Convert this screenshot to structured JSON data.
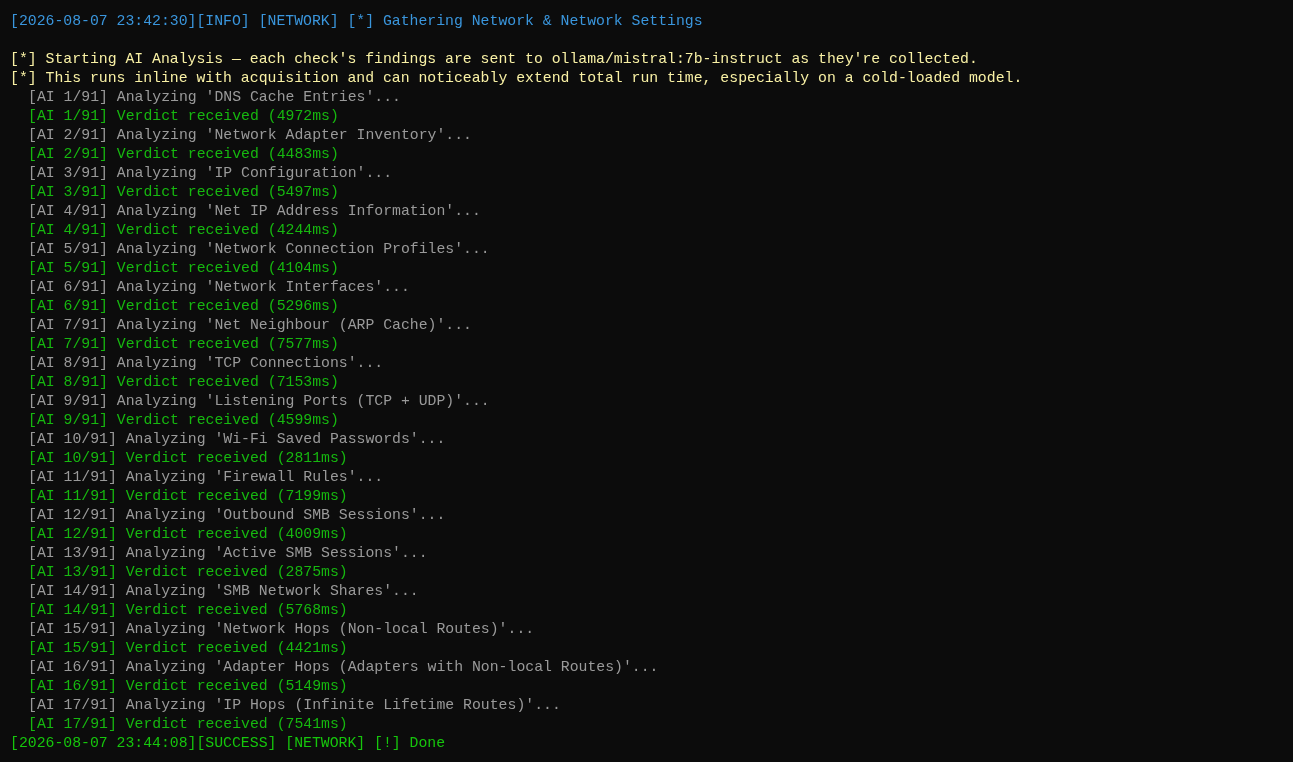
{
  "terminal": {
    "lines": [
      {
        "kind": "info",
        "text": "[2026-08-07 23:42:30][INFO] [NETWORK] [*] Gathering Network & Network Settings"
      },
      {
        "kind": "notice",
        "text": "[*] Starting AI Analysis — each check's findings are sent to ollama/mistral:7b-instruct as they're collected."
      },
      {
        "kind": "notice",
        "text": "[*] This runs inline with acquisition and can noticeably extend total run time, especially on a cold-loaded model."
      },
      {
        "kind": "progress",
        "text": "[AI 1/91] Analyzing 'DNS Cache Entries'..."
      },
      {
        "kind": "verdict",
        "text": "[AI 1/91] Verdict received (4972ms)"
      },
      {
        "kind": "progress",
        "text": "[AI 2/91] Analyzing 'Network Adapter Inventory'..."
      },
      {
        "kind": "verdict",
        "text": "[AI 2/91] Verdict received (4483ms)"
      },
      {
        "kind": "progress",
        "text": "[AI 3/91] Analyzing 'IP Configuration'..."
      },
      {
        "kind": "verdict",
        "text": "[AI 3/91] Verdict received (5497ms)"
      },
      {
        "kind": "progress",
        "text": "[AI 4/91] Analyzing 'Net IP Address Information'..."
      },
      {
        "kind": "verdict",
        "text": "[AI 4/91] Verdict received (4244ms)"
      },
      {
        "kind": "progress",
        "text": "[AI 5/91] Analyzing 'Network Connection Profiles'..."
      },
      {
        "kind": "verdict",
        "text": "[AI 5/91] Verdict received (4104ms)"
      },
      {
        "kind": "progress",
        "text": "[AI 6/91] Analyzing 'Network Interfaces'..."
      },
      {
        "kind": "verdict",
        "text": "[AI 6/91] Verdict received (5296ms)"
      },
      {
        "kind": "progress",
        "text": "[AI 7/91] Analyzing 'Net Neighbour (ARP Cache)'..."
      },
      {
        "kind": "verdict",
        "text": "[AI 7/91] Verdict received (7577ms)"
      },
      {
        "kind": "progress",
        "text": "[AI 8/91] Analyzing 'TCP Connections'..."
      },
      {
        "kind": "verdict",
        "text": "[AI 8/91] Verdict received (7153ms)"
      },
      {
        "kind": "progress",
        "text": "[AI 9/91] Analyzing 'Listening Ports (TCP + UDP)'..."
      },
      {
        "kind": "verdict",
        "text": "[AI 9/91] Verdict received (4599ms)"
      },
      {
        "kind": "progress",
        "text": "[AI 10/91] Analyzing 'Wi-Fi Saved Passwords'..."
      },
      {
        "kind": "verdict",
        "text": "[AI 10/91] Verdict received (2811ms)"
      },
      {
        "kind": "progress",
        "text": "[AI 11/91] Analyzing 'Firewall Rules'..."
      },
      {
        "kind": "verdict",
        "text": "[AI 11/91] Verdict received (7199ms)"
      },
      {
        "kind": "progress",
        "text": "[AI 12/91] Analyzing 'Outbound SMB Sessions'..."
      },
      {
        "kind": "verdict",
        "text": "[AI 12/91] Verdict received (4009ms)"
      },
      {
        "kind": "progress",
        "text": "[AI 13/91] Analyzing 'Active SMB Sessions'..."
      },
      {
        "kind": "verdict",
        "text": "[AI 13/91] Verdict received (2875ms)"
      },
      {
        "kind": "progress",
        "text": "[AI 14/91] Analyzing 'SMB Network Shares'..."
      },
      {
        "kind": "verdict",
        "text": "[AI 14/91] Verdict received (5768ms)"
      },
      {
        "kind": "progress",
        "text": "[AI 15/91] Analyzing 'Network Hops (Non-local Routes)'..."
      },
      {
        "kind": "verdict",
        "text": "[AI 15/91] Verdict received (4421ms)"
      },
      {
        "kind": "progress",
        "text": "[AI 16/91] Analyzing 'Adapter Hops (Adapters with Non-local Routes)'..."
      },
      {
        "kind": "verdict",
        "text": "[AI 16/91] Verdict received (5149ms)"
      },
      {
        "kind": "progress",
        "text": "[AI 17/91] Analyzing 'IP Hops (Infinite Lifetime Routes)'..."
      },
      {
        "kind": "verdict",
        "text": "[AI 17/91] Verdict received (7541ms)"
      },
      {
        "kind": "success",
        "text": "[2026-08-07 23:44:08][SUCCESS] [NETWORK] [!] Done"
      }
    ]
  }
}
